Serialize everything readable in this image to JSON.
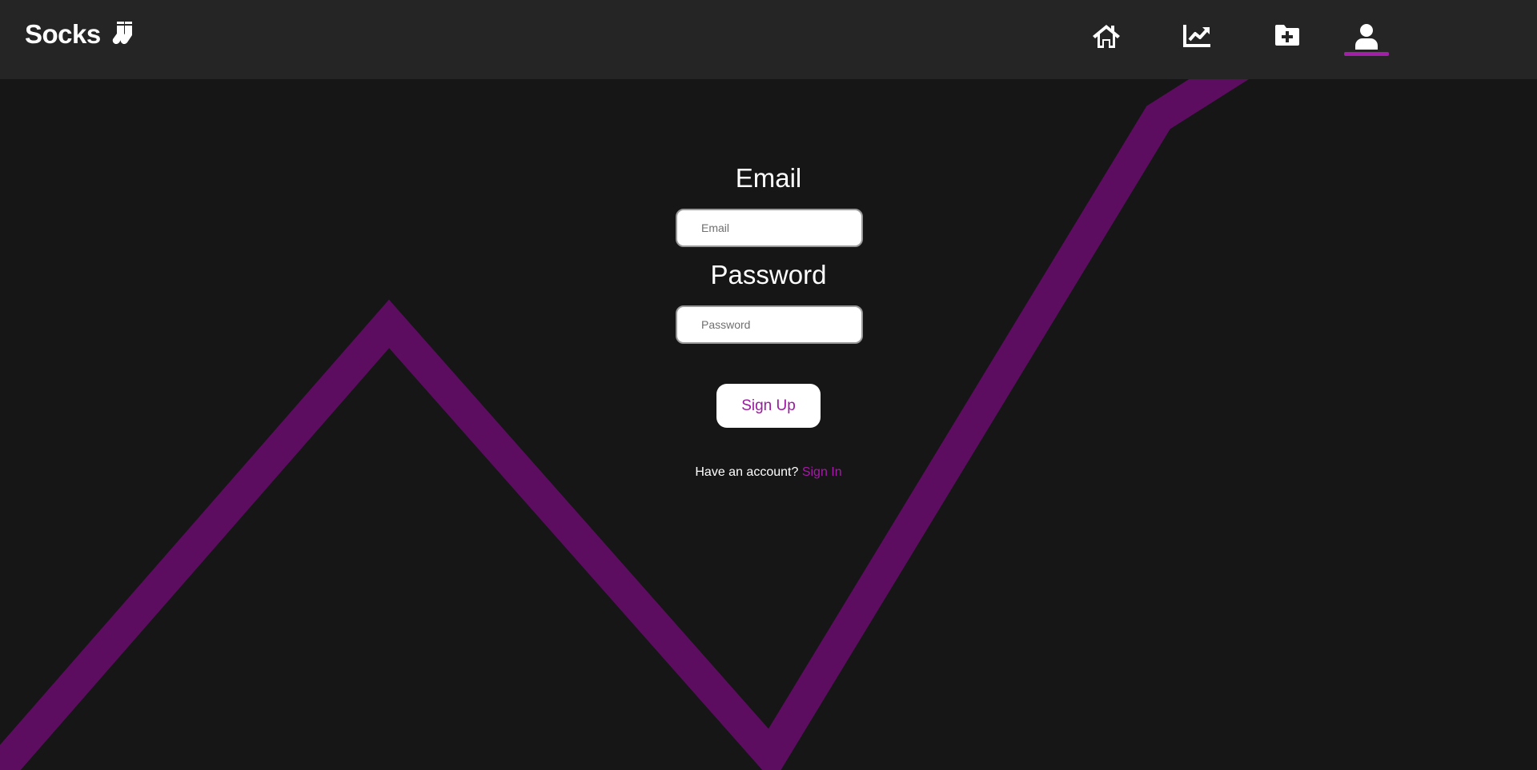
{
  "navbar": {
    "brand_text": "Socks",
    "brand_icon": "socks-icon",
    "items": [
      {
        "icon": "home-icon",
        "active": false
      },
      {
        "icon": "chart-line-icon",
        "active": false
      },
      {
        "icon": "folder-plus-icon",
        "active": false
      },
      {
        "icon": "user-icon",
        "active": true
      }
    ],
    "active_color": "#a020a8"
  },
  "form": {
    "email_label": "Email",
    "email_placeholder": "Email",
    "email_value": "",
    "password_label": "Password",
    "password_placeholder": "Password",
    "password_value": "",
    "submit_label": "Sign Up",
    "account_prompt": "Have an account?",
    "signin_link": "Sign In"
  },
  "colors": {
    "background": "#161616",
    "navbar": "#252525",
    "accent": "#a51aa8",
    "background_line": "#5c0d60"
  }
}
